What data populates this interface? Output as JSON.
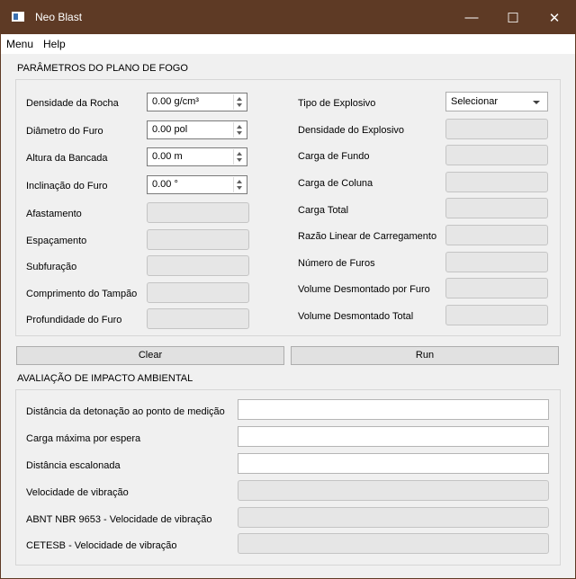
{
  "window": {
    "title": "Neo Blast",
    "minimize_glyph": "—",
    "maximize_glyph": "☐",
    "close_glyph": "✕"
  },
  "menubar": {
    "items": [
      "Menu",
      "Help"
    ]
  },
  "plano": {
    "title": "PARÂMETROS DO PLANO DE FOGO",
    "left": {
      "densidade_rocha": {
        "label": "Densidade da Rocha",
        "value": "0.00 g/cm³"
      },
      "diametro_furo": {
        "label": "Diâmetro do Furo",
        "value": "0.00 pol"
      },
      "altura_bancada": {
        "label": "Altura da Bancada",
        "value": "0.00 m"
      },
      "inclinacao_furo": {
        "label": "Inclinação do Furo",
        "value": "0.00 °"
      },
      "afastamento": {
        "label": "Afastamento"
      },
      "espacamento": {
        "label": "Espaçamento"
      },
      "subfuracao": {
        "label": "Subfuração"
      },
      "comprimento_tampao": {
        "label": "Comprimento do Tampão"
      },
      "profundidade_furo": {
        "label": "Profundidade do Furo"
      }
    },
    "right": {
      "tipo_explosivo": {
        "label": "Tipo de Explosivo",
        "value": "Selecionar"
      },
      "densidade_explosivo": {
        "label": "Densidade do Explosivo"
      },
      "carga_fundo": {
        "label": "Carga de Fundo"
      },
      "carga_coluna": {
        "label": "Carga de Coluna"
      },
      "carga_total": {
        "label": "Carga Total"
      },
      "razao_linear": {
        "label": "Razão Linear de Carregamento"
      },
      "numero_furos": {
        "label": "Número de Furos"
      },
      "volume_por_furo": {
        "label": "Volume Desmontado por Furo"
      },
      "volume_total": {
        "label": "Volume Desmontado Total"
      }
    }
  },
  "buttons": {
    "clear": "Clear",
    "run": "Run"
  },
  "impacto": {
    "title": "AVALIAÇÃO DE IMPACTO AMBIENTAL",
    "distancia_detonacao": {
      "label": "Distância da detonação ao ponto de medição",
      "value": ""
    },
    "carga_maxima": {
      "label": "Carga máxima por espera",
      "value": ""
    },
    "distancia_escalonada": {
      "label": "Distância escalonada",
      "value": ""
    },
    "velocidade_vibracao": {
      "label": "Velocidade de vibração"
    },
    "abnt_velocidade": {
      "label": "ABNT NBR 9653 - Velocidade de vibração"
    },
    "cetesb_velocidade": {
      "label": "CETESB - Velocidade de vibração"
    }
  }
}
